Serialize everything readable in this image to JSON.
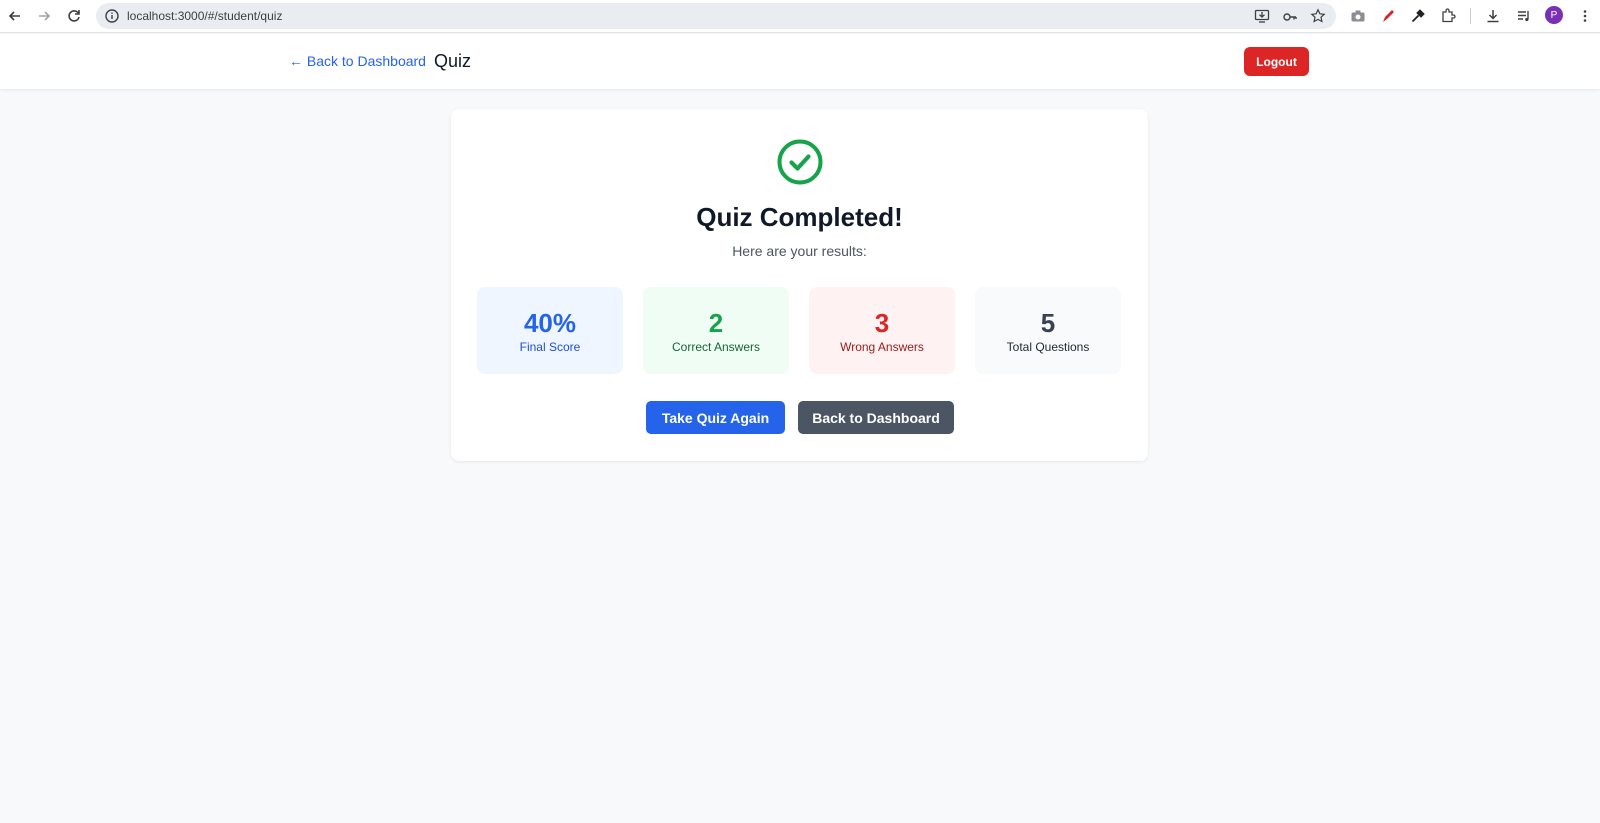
{
  "browser": {
    "url": "localhost:3000/#/student/quiz",
    "avatar_letter": "P",
    "avatar_color": "#7b2fb5",
    "icons": [
      "back-icon",
      "forward-icon",
      "reload-icon",
      "info-icon",
      "install-icon",
      "password-key-icon",
      "bookmark-star-icon",
      "camera-icon",
      "pen-icon",
      "eyedropper-icon",
      "extensions-icon",
      "download-icon",
      "media-controls-icon",
      "menu-icon"
    ]
  },
  "header": {
    "back_link": "← Back to Dashboard",
    "title": "Quiz",
    "logout_label": "Logout"
  },
  "results": {
    "heading": "Quiz Completed!",
    "subheading": "Here are your results:",
    "stats": [
      {
        "value": "40%",
        "label": "Final Score",
        "color": "#2563eb"
      },
      {
        "value": "2",
        "label": "Correct Answers",
        "color": "#16a34a"
      },
      {
        "value": "3",
        "label": "Wrong Answers",
        "color": "#dc2626"
      },
      {
        "value": "5",
        "label": "Total Questions",
        "color": "#374151"
      }
    ],
    "buttons": {
      "retake": "Take Quiz Again",
      "dashboard": "Back to Dashboard"
    }
  },
  "colors": {
    "primary": "#2563eb",
    "danger": "#dc2626",
    "success": "#16a34a",
    "secondary": "#4b5563"
  }
}
